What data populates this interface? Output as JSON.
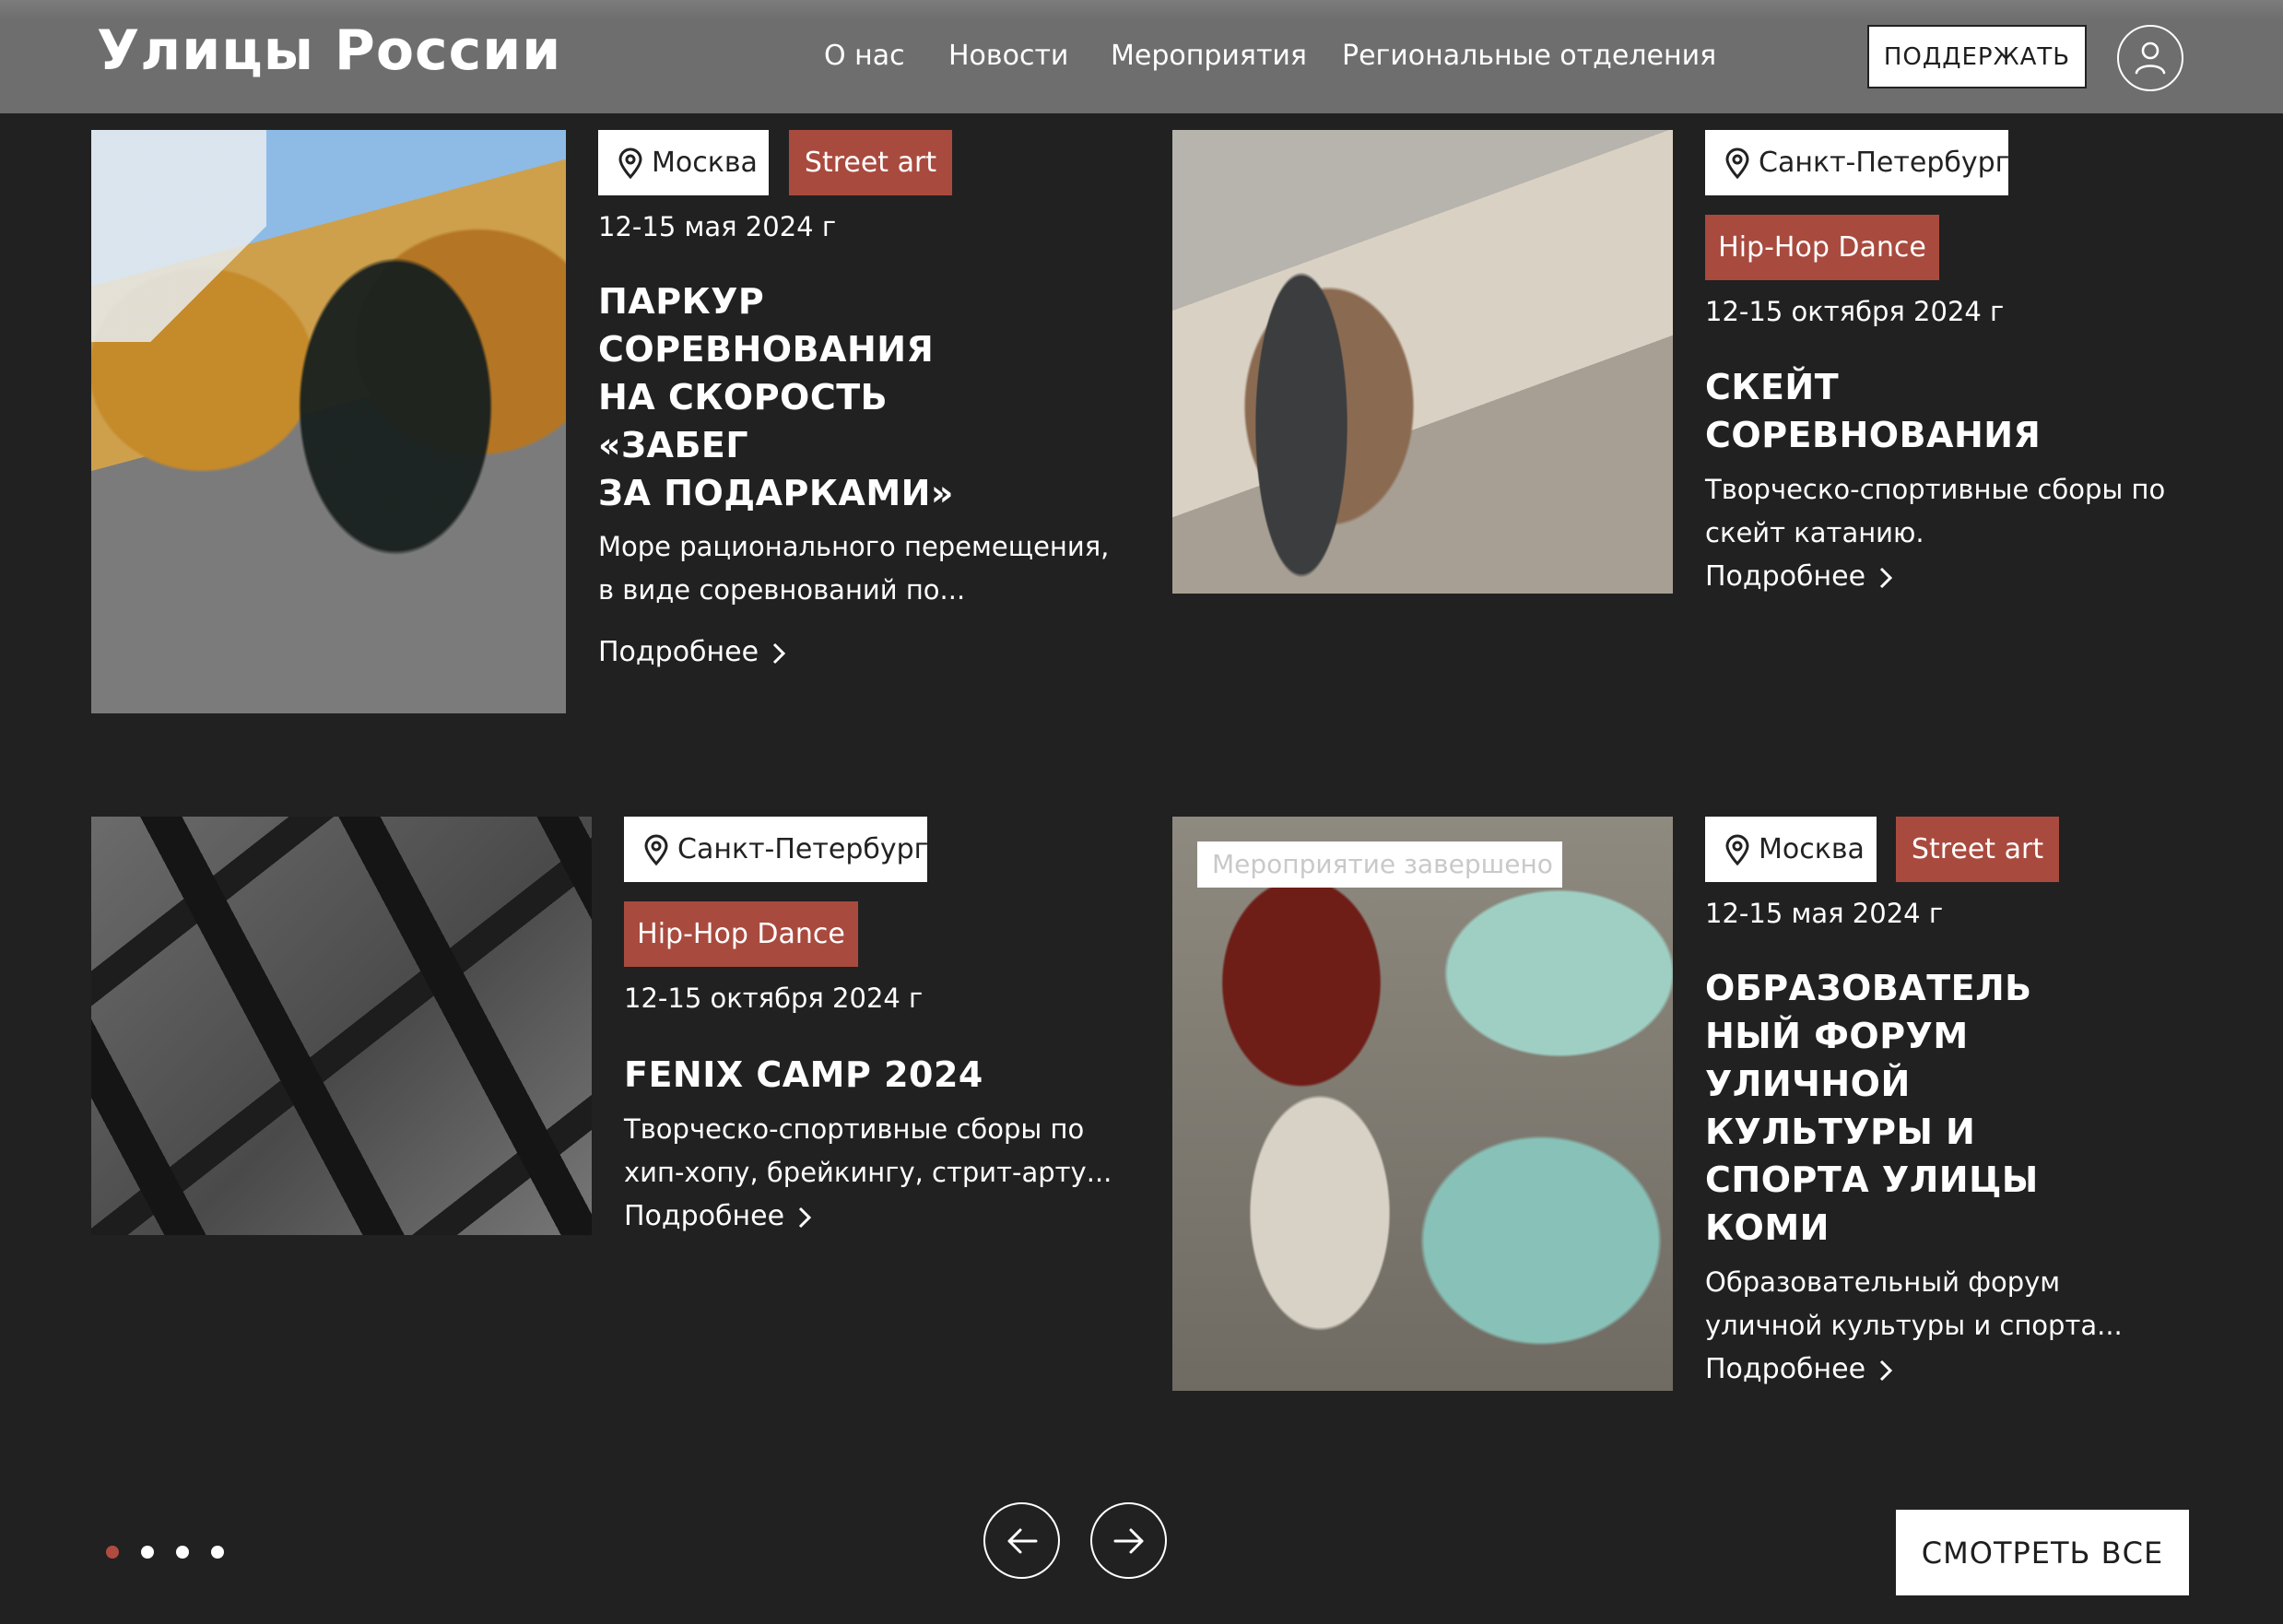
{
  "header": {
    "logo": "Улицы России",
    "nav": [
      "О нас",
      "Новости",
      "Мероприятия",
      "Региональные отделения"
    ],
    "support_label": "ПОДДЕРЖАТЬ",
    "user_icon": "user-icon"
  },
  "cards": [
    {
      "city": "Москва",
      "category": "Street art",
      "date": "12-15 мая 2024 г",
      "title_lines": [
        "ПАРКУР",
        "СОРЕВНОВАНИЯ",
        "НА СКОРОСТЬ",
        "«ЗАБЕГ",
        "ЗА ПОДАРКАМИ»"
      ],
      "desc_lines": [
        "Море рационального перемещения,",
        "в виде соревнований по..."
      ],
      "more": "Подробнее"
    },
    {
      "city": "Санкт-Петербург",
      "category": "Hip-Hop Dance",
      "date": "12-15 октября 2024 г",
      "title_lines": [
        "СКЕЙТ",
        "СОРЕВНОВАНИЯ"
      ],
      "desc_lines": [
        "Творческо-спортивные сборы по",
        "скейт катанию."
      ],
      "more": "Подробнее"
    },
    {
      "city": "Санкт-Петербург",
      "category": "Hip-Hop Dance",
      "date": "12-15 октября 2024 г",
      "title_lines": [
        "FENIX CAMP 2024"
      ],
      "desc_lines": [
        "Творческо-спортивные сборы по",
        "хип-хопу, брейкингу, стрит-арту..."
      ],
      "more": "Подробнее"
    },
    {
      "status": "Мероприятие завершено",
      "city": "Москва",
      "category": "Street art",
      "date": "12-15 мая 2024 г",
      "title_lines": [
        "ОБРАЗОВАТЕЛЬ",
        "НЫЙ ФОРУМ",
        "УЛИЧНОЙ",
        "КУЛЬТУРЫ И",
        "СПОРТА УЛИЦЫ",
        "КОМИ"
      ],
      "desc_lines": [
        "Образовательный форум",
        "уличной культуры и спорта..."
      ],
      "more": "Подробнее"
    }
  ],
  "pagination": {
    "pages": 4,
    "active": 1
  },
  "view_all_label": "СМОТРЕТЬ ВСЕ",
  "colors": {
    "background": "#212121",
    "header": "#6e6e6e",
    "accent": "#a94a3e",
    "active_dot": "#b04b3f"
  }
}
